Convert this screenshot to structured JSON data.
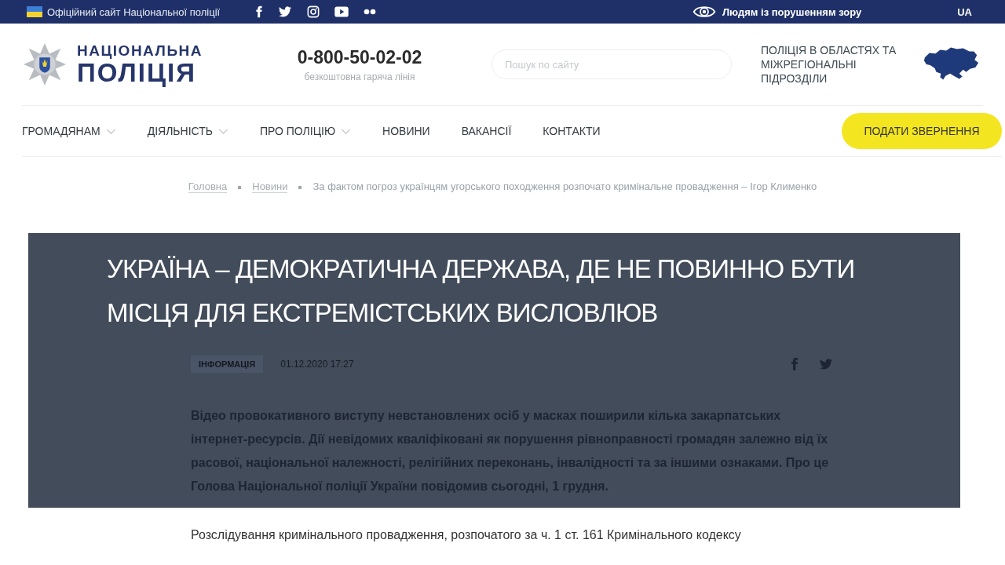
{
  "top_bar": {
    "official_text": "Офіційний сайт Національної поліції",
    "social": [
      {
        "kind": "facebook"
      },
      {
        "kind": "twitter"
      },
      {
        "kind": "instagram"
      },
      {
        "kind": "youtube"
      },
      {
        "kind": "flickr"
      }
    ],
    "accessibility": "Людям із порушенням зору",
    "language": "UA"
  },
  "header": {
    "logo_lines": [
      "НАЦІОНАЛЬНА",
      "ПОЛІЦІЯ"
    ],
    "phone": "0-800-50-02-02",
    "phone_caption": "безкоштовна гаряча лінія",
    "search": {
      "placeholder": "Пошук по сайту"
    },
    "regions_link": "ПОЛІЦІЯ В ОБЛАСТЯХ ТА МІЖРЕГІОНАЛЬНІ ПІДРОЗДІЛИ"
  },
  "nav": {
    "items": [
      {
        "label": "ГРОМАДЯНАМ",
        "dropdown": true
      },
      {
        "label": "ДІЯЛЬНІСТЬ",
        "dropdown": true
      },
      {
        "label": "ПРО ПОЛІЦІЮ",
        "dropdown": true
      },
      {
        "label": "НОВИНИ",
        "dropdown": false
      },
      {
        "label": "ВАКАНСІЇ",
        "dropdown": false
      },
      {
        "label": "КОНТАКТИ",
        "dropdown": false
      }
    ],
    "cta": "ПОДАТИ ЗВЕРНЕННЯ"
  },
  "breadcrumb": [
    {
      "kind": "link",
      "label": "Головна"
    },
    {
      "kind": "link",
      "label": "Новини"
    },
    {
      "kind": "current",
      "label": "За фактом погроз українцям угорського походження розпочато кримінальне провадження – Ігор Клименко"
    }
  ],
  "caption": {
    "lines": [
      "УКРАЇНА – ДЕМОКРАТИЧНА ДЕРЖАВА, ДЕ НЕ ПОВИННО БУТИ",
      "МІСЦЯ ДЛЯ ЕКСТРЕМІСТСЬКИХ ВИСЛОВЛЮВ"
    ]
  },
  "article": {
    "tag": "ІНФОРМАЦІЯ",
    "date": "01.12.2020 17:27",
    "share": [
      {
        "kind": "facebook"
      },
      {
        "kind": "twitter"
      }
    ],
    "lead": "Відео провокативного виступу невстановлених осіб у масках поширили кілька закарпатських інтернет-ресурсів. Дії  невідомих кваліфіковані як порушення рівноправності громадян залежно від їх расової, національної належності, релігійних переконань, інвалідності та за іншими ознаками. Про це Голова Національної поліції України повідомив сьогодні, 1 грудня.",
    "paragraph": "Розслідування кримінального провадження, розпочатого за ч. 1 ст. 161 Кримінального кодексу"
  }
}
